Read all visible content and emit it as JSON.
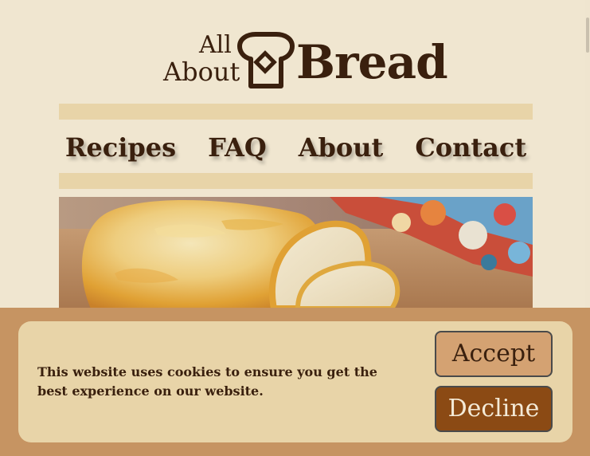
{
  "logo": {
    "line1": "All",
    "line2": "About",
    "wordmark": "Bread",
    "icon": "bread-slice-icon"
  },
  "nav": {
    "items": [
      "Recipes",
      "FAQ",
      "About",
      "Contact"
    ]
  },
  "hero": {
    "image": "sliced-bread-loaf-photo"
  },
  "cookie": {
    "message": "This website uses cookies to ensure you get the best experience on our website.",
    "accept_label": "Accept",
    "decline_label": "Decline"
  },
  "colors": {
    "background": "#f0e6d0",
    "text": "#3a200e",
    "band": "#e8d4a8",
    "cookie_bar": "#c69462",
    "accept": "#d4a272",
    "decline": "#8b4a14"
  }
}
